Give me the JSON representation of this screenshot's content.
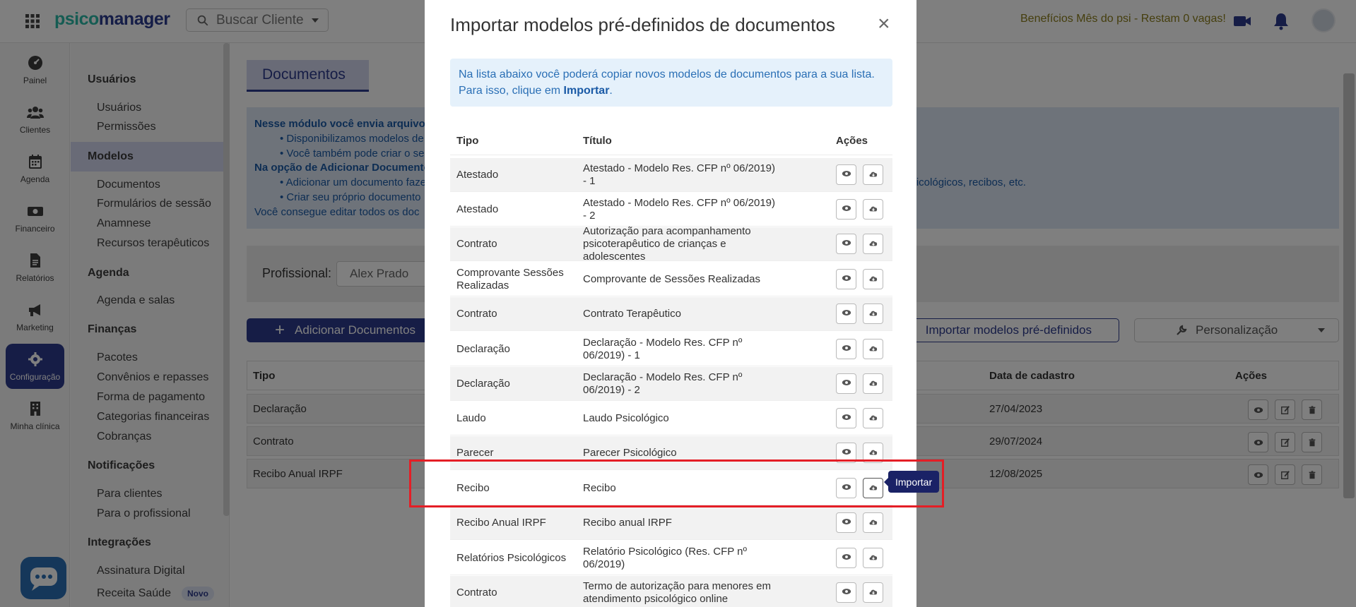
{
  "topbar": {
    "logo_part1": "psico",
    "logo_part2": "manager",
    "search_label": "Buscar Cliente",
    "promo": "Benefícios Mês do psi - Restam 0 vagas!"
  },
  "rail": {
    "items": [
      {
        "label": "Painel",
        "icon": "dashboard-icon"
      },
      {
        "label": "Clientes",
        "icon": "users-icon"
      },
      {
        "label": "Agenda",
        "icon": "calendar-icon"
      },
      {
        "label": "Financeiro",
        "icon": "money-icon"
      },
      {
        "label": "Relatórios",
        "icon": "file-icon"
      },
      {
        "label": "Marketing",
        "icon": "megaphone-icon"
      },
      {
        "label": "Configuração",
        "icon": "gear-icon"
      },
      {
        "label": "Minha clínica",
        "icon": "building-icon"
      }
    ]
  },
  "menu": {
    "sections": [
      {
        "title": "Usuários",
        "links": [
          "Usuários",
          "Permissões"
        ]
      },
      {
        "title": "Modelos",
        "links": [
          "Documentos",
          "Formulários de sessão",
          "Anamnese",
          "Recursos terapêuticos"
        ]
      },
      {
        "title": "Agenda",
        "links": [
          "Agenda e salas"
        ]
      },
      {
        "title": "Finanças",
        "links": [
          "Pacotes",
          "Convênios e repasses",
          "Forma de pagamento",
          "Categorias financeiras",
          "Cobranças"
        ]
      },
      {
        "title": "Notificações",
        "links": [
          "Para clientes",
          "Para o profissional"
        ]
      },
      {
        "title": "Integrações",
        "links": [
          "Assinatura Digital",
          "Receita Saúde"
        ]
      }
    ],
    "badge_novo": "Novo"
  },
  "main": {
    "page_title": "Documentos",
    "info_lines": [
      "Nesse módulo você envia arquivos",
      "Disponibilizamos modelos de",
      "Você também pode criar o se",
      "Na opção de Adicionar Documento",
      "Adicionar um documento faze",
      "Criar seu próprio documento",
      "Você consegue editar todos os doc"
    ],
    "info_tail": "psicológicos, recibos, etc.",
    "profissional_label": "Profissional:",
    "profissional_value": "Alex Prado",
    "add_button": "Adicionar Documentos",
    "import_button": "Importar modelos pré-definidos",
    "personalizacao_button": "Personalização",
    "table": {
      "headers": {
        "tipo": "Tipo",
        "data": "Data de cadastro",
        "acoes": "Ações"
      },
      "rows": [
        {
          "tipo": "Declaração",
          "data": "27/04/2023"
        },
        {
          "tipo": "Contrato",
          "data": "29/07/2024"
        },
        {
          "tipo": "Recibo Anual IRPF",
          "data": "12/08/2025"
        }
      ]
    }
  },
  "modal": {
    "title": "Importar modelos pré-definidos de documentos",
    "close": "×",
    "info_text": "Na lista abaixo você poderá copiar novos modelos de documentos para a sua lista. Para isso, clique em ",
    "info_bold": "Importar",
    "info_end": ".",
    "headers": {
      "tipo": "Tipo",
      "titulo": "Título",
      "acoes": "Ações"
    },
    "rows": [
      {
        "tipo": "Atestado",
        "titulo": "Atestado - Modelo Res. CFP nº 06/2019) - 1"
      },
      {
        "tipo": "Atestado",
        "titulo": "Atestado - Modelo Res. CFP nº 06/2019) - 2"
      },
      {
        "tipo": "Contrato",
        "titulo": "Autorização para acompanhamento psicoterapêutico de crianças e adolescentes"
      },
      {
        "tipo": "Comprovante Sessões Realizadas",
        "titulo": "Comprovante de Sessões Realizadas"
      },
      {
        "tipo": "Contrato",
        "titulo": "Contrato Terapêutico"
      },
      {
        "tipo": "Declaração",
        "titulo": "Declaração - Modelo Res. CFP nº 06/2019) - 1"
      },
      {
        "tipo": "Declaração",
        "titulo": "Declaração - Modelo Res. CFP nº 06/2019) - 2"
      },
      {
        "tipo": "Laudo",
        "titulo": "Laudo Psicológico"
      },
      {
        "tipo": "Parecer",
        "titulo": "Parecer Psicológico"
      },
      {
        "tipo": "Recibo",
        "titulo": "Recibo"
      },
      {
        "tipo": "Recibo Anual IRPF",
        "titulo": "Recibo anual IRPF"
      },
      {
        "tipo": "Relatórios Psicológicos",
        "titulo": "Relatório Psicológico (Res. CFP nº 06/2019)"
      },
      {
        "tipo": "Contrato",
        "titulo": "Termo de autorização para menores em atendimento psicológico online"
      }
    ],
    "tooltip": "Importar"
  },
  "colors": {
    "primary": "#2d3a8c",
    "teal": "#2bb8a6",
    "highlight": "#e41e26",
    "info_bg": "#e5f1fb"
  }
}
